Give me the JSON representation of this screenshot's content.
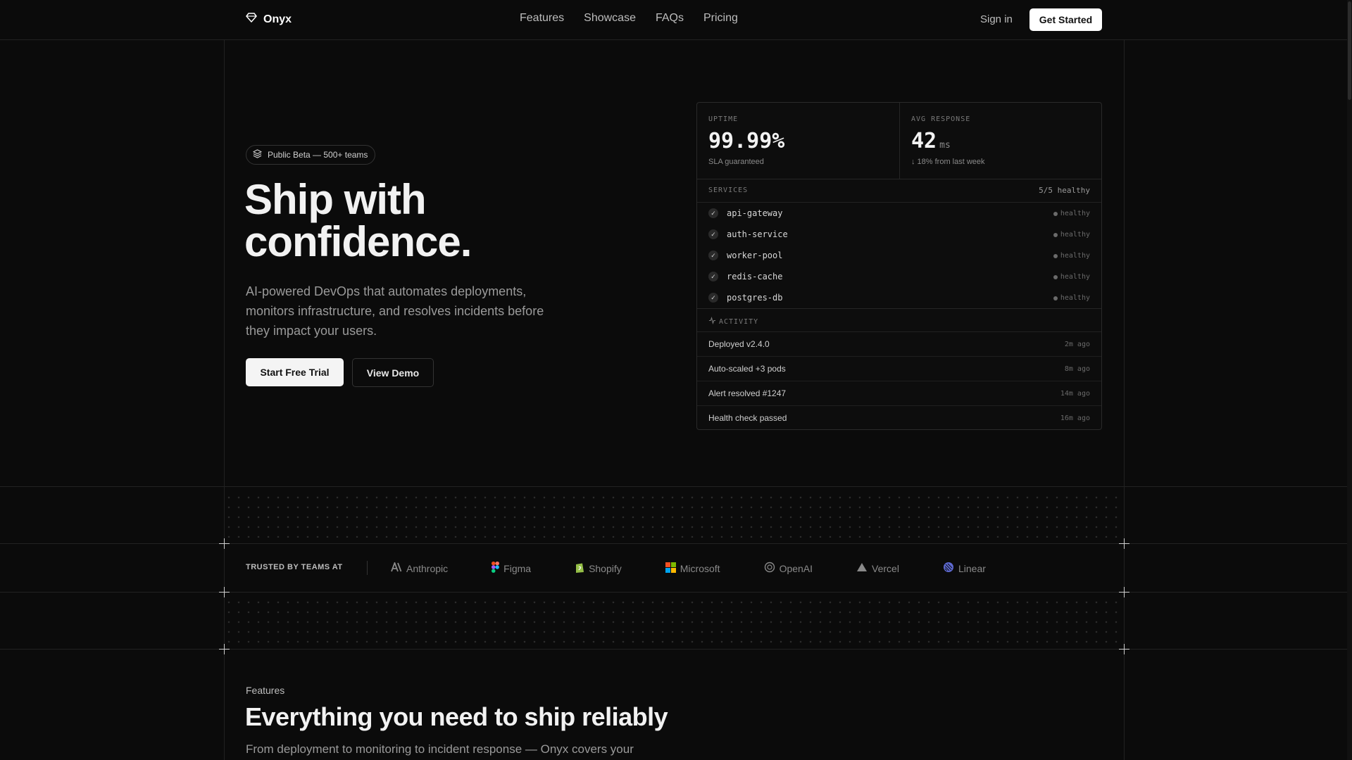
{
  "nav": {
    "brand": "Onyx",
    "links": [
      "Features",
      "Showcase",
      "FAQs",
      "Pricing"
    ],
    "sign_in": "Sign in",
    "cta": "Get Started"
  },
  "hero": {
    "badge": "Public Beta — 500+ teams",
    "title_line1": "Ship with",
    "title_line2": "confidence.",
    "subtitle": "AI-powered DevOps that automates deployments, monitors infrastructure, and resolves incidents before they impact your users.",
    "primary_button": "Start Free Trial",
    "secondary_button": "View Demo"
  },
  "dashboard": {
    "uptime": {
      "label": "UPTIME",
      "value": "99.99%",
      "sub": "SLA guaranteed"
    },
    "response": {
      "label": "AVG RESPONSE",
      "value": "42",
      "unit": "ms",
      "sub": "↓ 18% from last week"
    },
    "services_label": "SERVICES",
    "services_count": "5/5 healthy",
    "services": [
      {
        "name": "api-gateway",
        "status": "healthy"
      },
      {
        "name": "auth-service",
        "status": "healthy"
      },
      {
        "name": "worker-pool",
        "status": "healthy"
      },
      {
        "name": "redis-cache",
        "status": "healthy"
      },
      {
        "name": "postgres-db",
        "status": "healthy"
      }
    ],
    "activity_label": "ACTIVITY",
    "activity": [
      {
        "text": "Deployed v2.4.0",
        "time": "2m ago"
      },
      {
        "text": "Auto-scaled +3 pods",
        "time": "8m ago"
      },
      {
        "text": "Alert resolved #1247",
        "time": "14m ago"
      },
      {
        "text": "Health check passed",
        "time": "16m ago"
      }
    ]
  },
  "trusted": {
    "label": "TRUSTED BY TEAMS AT",
    "logos": [
      {
        "name": "Anthropic",
        "icon": "anthropic-icon"
      },
      {
        "name": "Figma",
        "icon": "figma-icon"
      },
      {
        "name": "Shopify",
        "icon": "shopify-icon"
      },
      {
        "name": "Microsoft",
        "icon": "microsoft-icon"
      },
      {
        "name": "OpenAI",
        "icon": "openai-icon"
      },
      {
        "name": "Vercel",
        "icon": "vercel-icon"
      },
      {
        "name": "Linear",
        "icon": "linear-icon"
      }
    ]
  },
  "features": {
    "eyebrow": "Features",
    "title": "Everything you need to ship reliably",
    "subtitle": "From deployment to monitoring to incident response — Onyx covers your"
  },
  "colors": {
    "background": "#0b0b0b",
    "text": "#e8e8e8",
    "muted": "#9a9a9a",
    "button_light": "#f4f4f4"
  }
}
